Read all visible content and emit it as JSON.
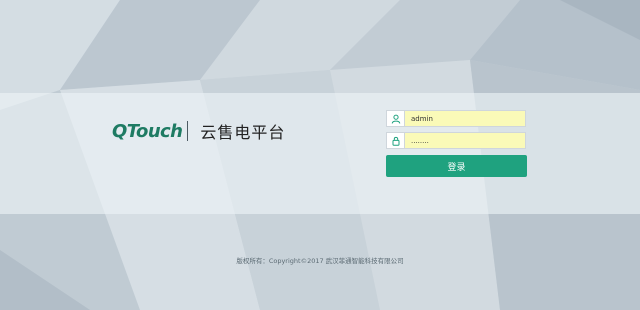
{
  "brand": {
    "logo_text": "QTouch",
    "platform_name": "云售电平台",
    "logo_color": "#1e7b63"
  },
  "login": {
    "username_value": "admin",
    "password_value": "........",
    "username_icon": "user-icon",
    "password_icon": "lock-icon",
    "login_label": "登录",
    "accent_color": "#1fa27f",
    "autofill_color": "#fafab8"
  },
  "footer": {
    "copyright": "版权所有：Copyright©2017 武汉菲通智能科技有限公司"
  }
}
